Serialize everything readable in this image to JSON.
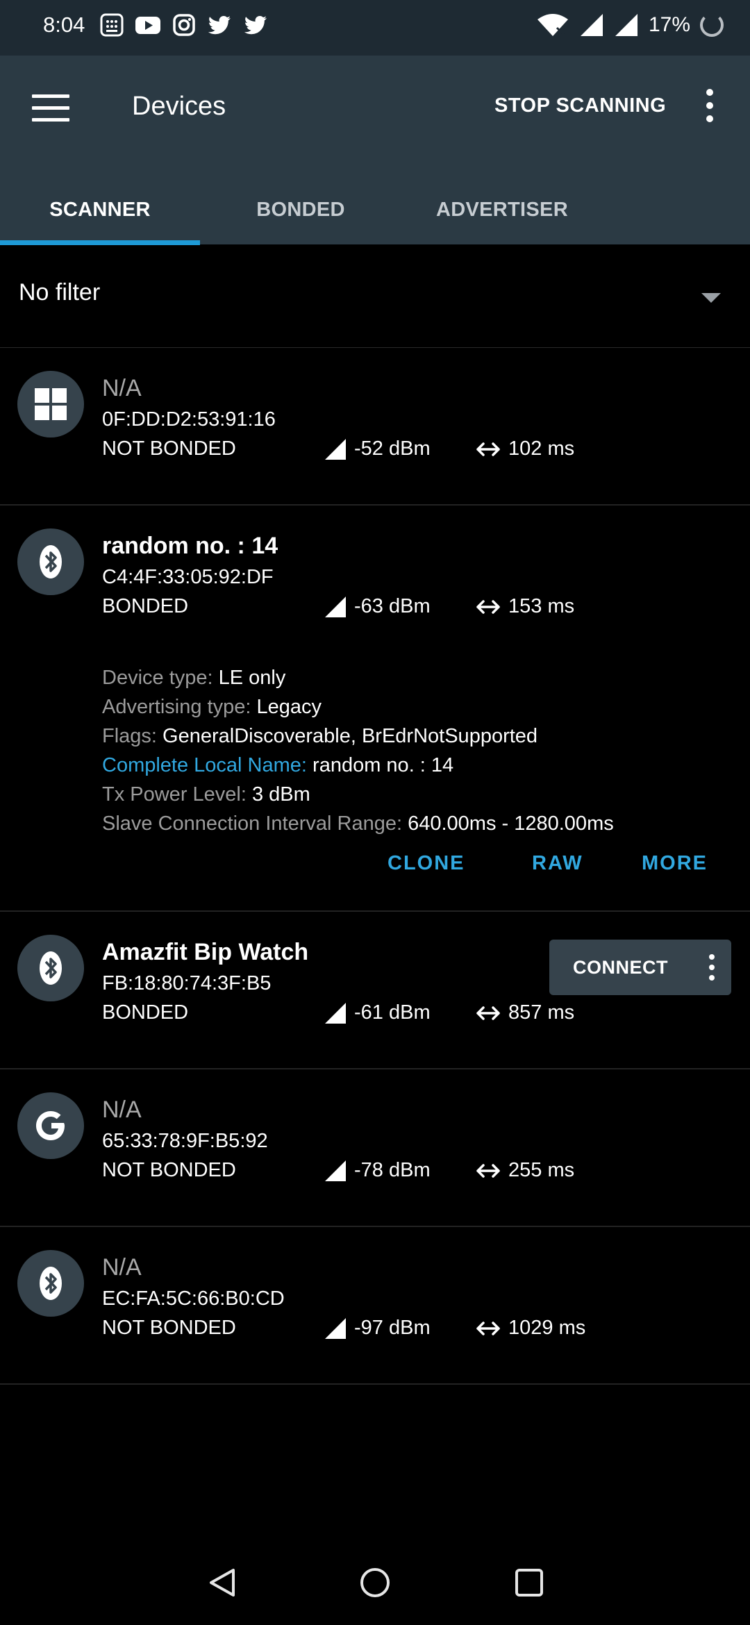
{
  "status_bar": {
    "time": "8:04",
    "battery": "17%",
    "left_icons": [
      "calculator-icon",
      "youtube-icon",
      "instagram-icon",
      "twitter-icon",
      "twitter-icon"
    ],
    "right_icons": [
      "wifi-icon",
      "signal-icon",
      "signal-icon",
      "battery-ring-icon"
    ]
  },
  "app_bar": {
    "title": "Devices",
    "stop_label": "STOP SCANNING"
  },
  "tabs": [
    {
      "label": "SCANNER",
      "active": true
    },
    {
      "label": "BONDED",
      "active": false
    },
    {
      "label": "ADVERTISER",
      "active": false
    }
  ],
  "filter": {
    "label": "No filter"
  },
  "devices": [
    {
      "name": "N/A",
      "address": "0F:DD:D2:53:91:16",
      "bond": "NOT BONDED",
      "rssi": "-52 dBm",
      "interval": "102 ms",
      "icon": "windows-icon"
    },
    {
      "name": "random no. : 14",
      "address": "C4:4F:33:05:92:DF",
      "bond": "BONDED",
      "rssi": "-63 dBm",
      "interval": "153 ms",
      "icon": "bluetooth-icon"
    },
    {
      "name": "Amazfit Bip Watch",
      "address": "FB:18:80:74:3F:B5",
      "bond": "BONDED",
      "rssi": "-61 dBm",
      "interval": "857 ms",
      "icon": "bluetooth-icon"
    },
    {
      "name": "N/A",
      "address": "65:33:78:9F:B5:92",
      "bond": "NOT BONDED",
      "rssi": "-78 dBm",
      "interval": "255 ms",
      "icon": "google-icon"
    },
    {
      "name": "N/A",
      "address": "EC:FA:5C:66:B0:CD",
      "bond": "NOT BONDED",
      "rssi": "-97 dBm",
      "interval": "1029 ms",
      "icon": "bluetooth-icon"
    }
  ],
  "details": {
    "device_type_k": "Device type:",
    "device_type_v": "LE only",
    "adv_type_k": "Advertising type:",
    "adv_type_v": "Legacy",
    "flags_k": "Flags:",
    "flags_v": "GeneralDiscoverable, BrEdrNotSupported",
    "local_name_k": "Complete Local Name:",
    "local_name_v": "random no. : 14",
    "tx_power_k": "Tx Power Level:",
    "tx_power_v": "3 dBm",
    "slave_k": "Slave Connection Interval Range:",
    "slave_v": "640.00ms - 1280.00ms"
  },
  "actions": {
    "clone": "CLONE",
    "raw": "RAW",
    "more": "MORE"
  },
  "connect": {
    "label": "CONNECT"
  },
  "colors": {
    "accent": "#1e9ad6",
    "app_bar": "#2b3a44",
    "avatar": "#36434c"
  }
}
